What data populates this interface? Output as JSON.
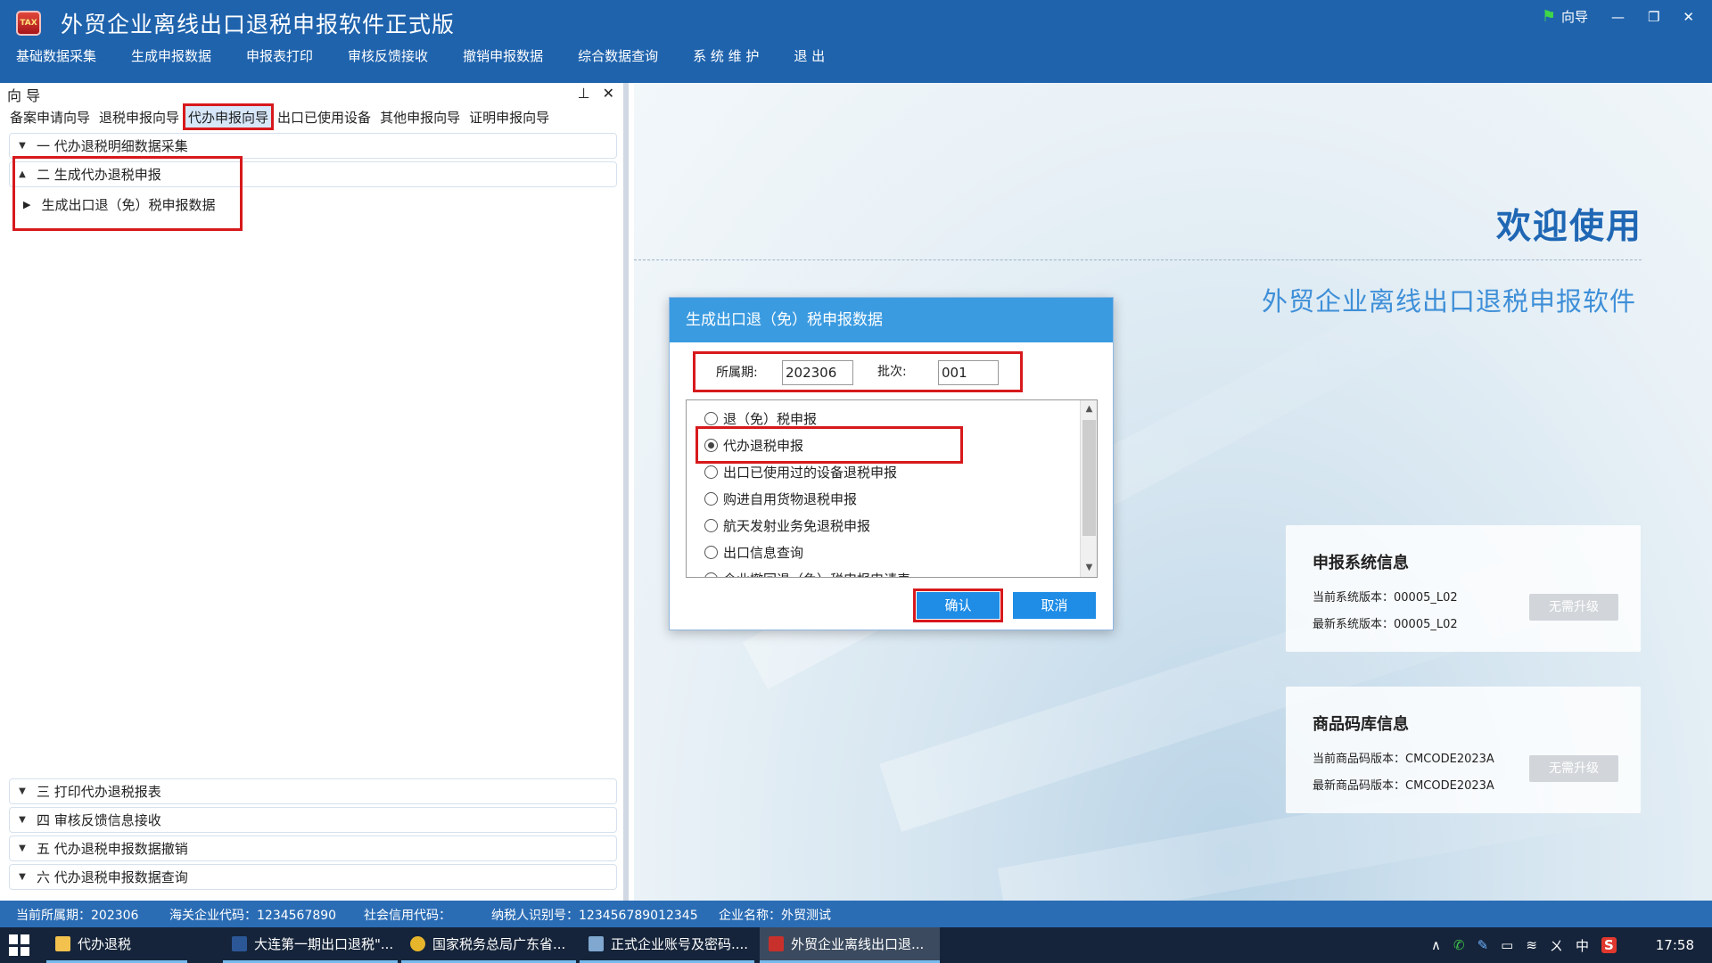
{
  "app": {
    "title": "外贸企业离线出口退税申报软件正式版",
    "logo_text": "TAX",
    "guide_label": "向导",
    "minimize": "—",
    "restore": "❐",
    "close": "✕"
  },
  "menu": [
    "基础数据采集",
    "生成申报数据",
    "申报表打印",
    "审核反馈接收",
    "撤销申报数据",
    "综合数据查询",
    "系 统 维 护",
    "退 出"
  ],
  "panel": {
    "title": "向 导",
    "pin": "⊥",
    "close": "✕",
    "tabs": [
      "备案申请向导",
      "退税申报向导",
      "代办申报向导",
      "出口已使用设备",
      "其他申报向导",
      "证明申报向导"
    ],
    "active_tab": "代办申报向导",
    "tree": [
      {
        "label": "一 代办退税明细数据采集",
        "arrow": "▼"
      },
      {
        "label": "二 生成代办退税申报",
        "arrow": "▲",
        "children": [
          "生成出口退（免）税申报数据"
        ]
      },
      {
        "label": "三 打印代办退税报表",
        "arrow": "▼"
      },
      {
        "label": "四 审核反馈信息接收",
        "arrow": "▼"
      },
      {
        "label": "五 代办退税申报数据撤销",
        "arrow": "▼"
      },
      {
        "label": "六 代办退税申报数据查询",
        "arrow": "▼"
      }
    ],
    "child_arrow": "▶"
  },
  "welcome": {
    "title": "欢迎使用",
    "subtitle": "外贸企业离线出口退税申报软件"
  },
  "system_info": {
    "title": "申报系统信息",
    "current_label": "当前系统版本：",
    "current_value": "00005_L02",
    "latest_label": "最新系统版本：",
    "latest_value": "00005_L02",
    "button": "无需升级"
  },
  "code_info": {
    "title": "商品码库信息",
    "current_label": "当前商品码版本：",
    "current_value": "CMCODE2023A",
    "latest_label": "最新商品码版本：",
    "latest_value": "CMCODE2023A",
    "button": "无需升级"
  },
  "dialog": {
    "title": "生成出口退（免）税申报数据",
    "period_label": "所属期:",
    "period_value": "202306",
    "batch_label": "批次:",
    "batch_value": "001",
    "options": [
      {
        "label": "退（免）税申报",
        "checked": false
      },
      {
        "label": "代办退税申报",
        "checked": true
      },
      {
        "label": "出口已使用过的设备退税申报",
        "checked": false
      },
      {
        "label": "购进自用货物退税申报",
        "checked": false
      },
      {
        "label": "航天发射业务免退税申报",
        "checked": false
      },
      {
        "label": "出口信息查询",
        "checked": false
      },
      {
        "label": "企业撤回退（免）税申报申请表",
        "checked": false
      }
    ],
    "scroll_up": "▲",
    "scroll_down": "▼",
    "confirm": "确认",
    "cancel": "取消"
  },
  "status": {
    "period": "当前所属期：202306",
    "customs_code": "海关企业代码：1234567890",
    "credit_code": "社会信用代码：",
    "taxpayer_id": "纳税人识别号：123456789012345",
    "company": "企业名称：外贸测试"
  },
  "taskbar": {
    "tasks": [
      {
        "label": "代办退税",
        "icon_color": "#f2c14e",
        "state": "open"
      },
      {
        "label": "大连第一期出口退税\"...",
        "icon_color": "#2b5797",
        "state": "open"
      },
      {
        "label": "国家税务总局广东省...",
        "icon_color": "#e7b52c",
        "state": "open"
      },
      {
        "label": "正式企业账号及密码....",
        "icon_color": "#7fa7cf",
        "state": "open"
      },
      {
        "label": "外贸企业离线出口退...",
        "icon_color": "#c8312b",
        "state": "active"
      }
    ],
    "tray": [
      "∧",
      "✆",
      "✎",
      "▭",
      "≋",
      "ㄨ",
      "中",
      "S"
    ],
    "clock": "17:58"
  },
  "colors": {
    "titlebar": "#1f63ad",
    "accent": "#1f8de6",
    "highlight": "#d7191c"
  }
}
